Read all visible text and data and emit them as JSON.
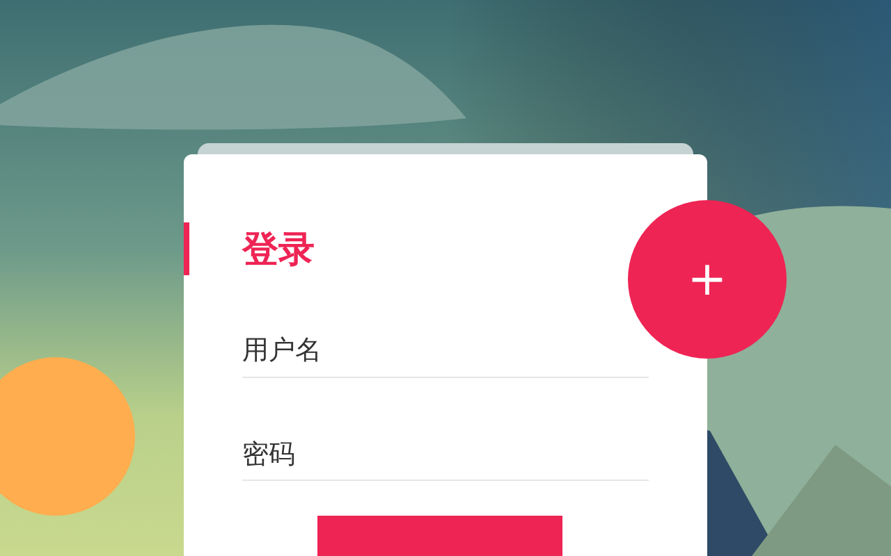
{
  "login_card": {
    "title": "登录",
    "fields": [
      {
        "placeholder": "用户名"
      },
      {
        "placeholder": "密码"
      }
    ]
  },
  "fab": {
    "label": "+"
  }
}
